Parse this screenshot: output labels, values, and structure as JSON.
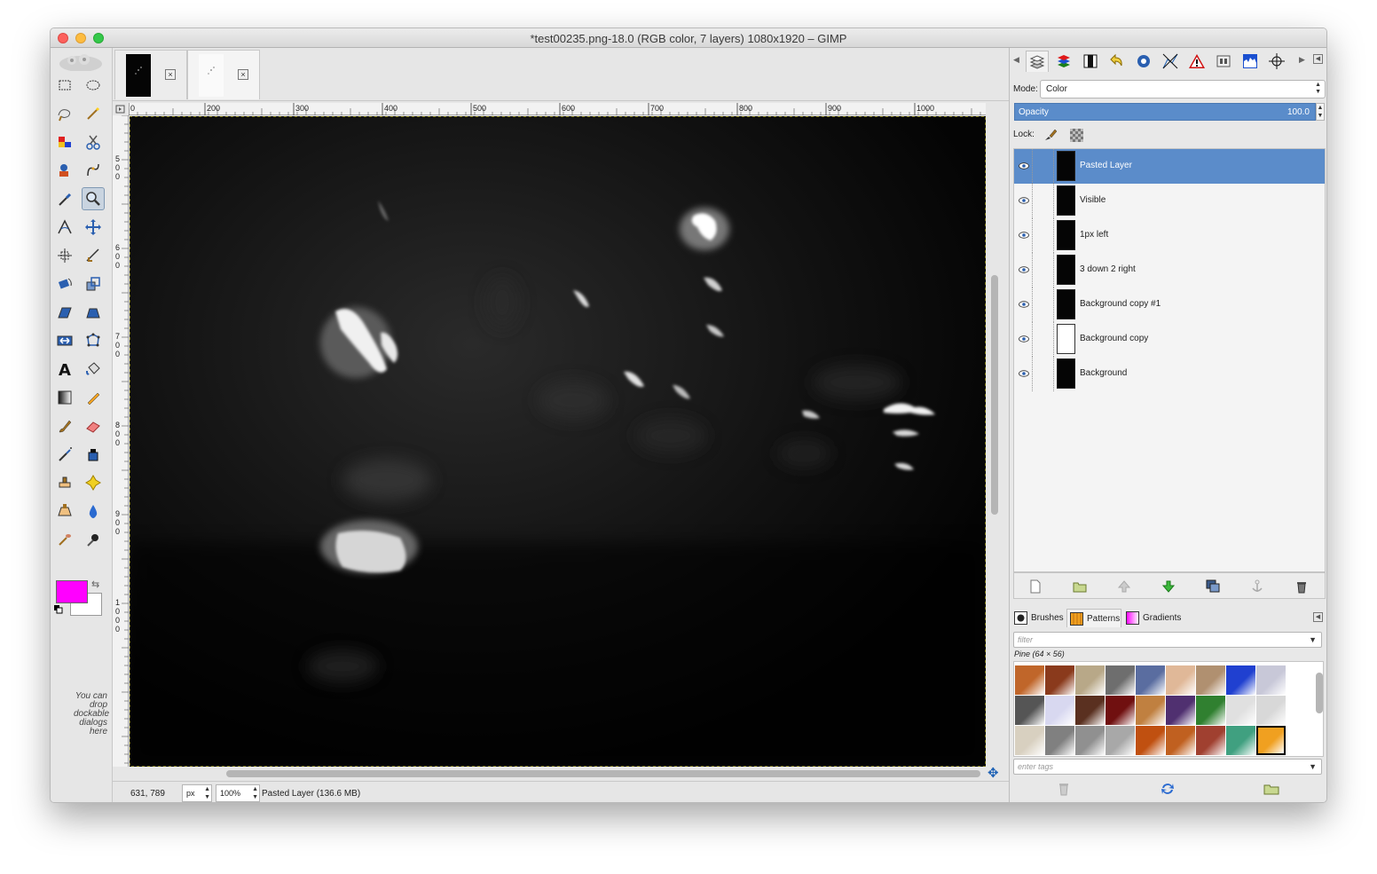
{
  "window": {
    "title": "*test00235.png-18.0 (RGB color, 7 layers) 1080x1920 – GIMP"
  },
  "toolbox": {
    "tools": [
      "rect-select-icon",
      "ellipse-select-icon",
      "free-select-icon",
      "fuzzy-select-icon",
      "by-color-select-icon",
      "scissors-select-icon",
      "foreground-select-icon",
      "paths-icon",
      "color-picker-icon",
      "zoom-icon",
      "measure-icon",
      "move-icon",
      "align-icon",
      "crop-icon",
      "rotate-icon",
      "scale-icon",
      "shear-icon",
      "perspective-icon",
      "flip-icon",
      "cage-icon",
      "text-icon",
      "bucket-fill-icon",
      "gradient-icon",
      "pencil-icon",
      "paintbrush-icon",
      "eraser-icon",
      "airbrush-icon",
      "ink-icon",
      "clone-icon",
      "heal-icon",
      "perspective-clone-icon",
      "blur-icon",
      "smudge-icon",
      "dodge-burn-icon"
    ],
    "active_tool": "zoom-icon",
    "fg_color": "#ff00ff",
    "bg_color": "#ffffff",
    "drop_hint": "You can drop dockable dialogs here"
  },
  "image_tabs": [
    {
      "name": "image-tab-test00235",
      "thumb": "dark",
      "close": "×"
    },
    {
      "name": "image-tab-second",
      "thumb": "light",
      "close": "×"
    }
  ],
  "rulers": {
    "h_labels": [
      "0",
      "200",
      "300",
      "400",
      "500",
      "600",
      "700",
      "800",
      "900",
      "1000"
    ],
    "v_labels": [
      "500",
      "600",
      "700",
      "800",
      "900",
      "1000"
    ]
  },
  "statusbar": {
    "coords": "631, 789",
    "unit": "px",
    "zoom": "100%",
    "layer_info": "Pasted Layer (136.6 MB)"
  },
  "layers_panel": {
    "mode_label": "Mode:",
    "mode_value": "Color",
    "opacity_label": "Opacity",
    "opacity_value": "100.0",
    "lock_label": "Lock:",
    "layers": [
      {
        "name": "Pasted Layer",
        "selected": true,
        "thumb": "dark"
      },
      {
        "name": "Visible",
        "selected": false,
        "thumb": "dark"
      },
      {
        "name": "1px left",
        "selected": false,
        "thumb": "dark"
      },
      {
        "name": "3 down 2 right",
        "selected": false,
        "thumb": "dark"
      },
      {
        "name": "Background copy #1",
        "selected": false,
        "thumb": "dark"
      },
      {
        "name": "Background copy",
        "selected": false,
        "thumb": "white"
      },
      {
        "name": "Background",
        "selected": false,
        "thumb": "dark"
      }
    ]
  },
  "resources_panel": {
    "tabs": [
      "Brushes",
      "Patterns",
      "Gradients"
    ],
    "active_tab": "Patterns",
    "filter_placeholder": "filter",
    "selected_pattern": "Pine (64 × 56)",
    "tags_placeholder": "enter tags",
    "pattern_colors": [
      "#c0662a",
      "#8a3a1c",
      "#b8a888",
      "#6e6e6e",
      "#5a6da0",
      "#e0b898",
      "#b09070",
      "#2040d0",
      "#c8c8d8",
      "#555555",
      "#d8d8f0",
      "#5a3020",
      "#701010",
      "#c08040",
      "#503070",
      "#308030",
      "#e0e0e0",
      "#d8d8d8",
      "#d8d0c0",
      "#808080",
      "#909090",
      "#a8a8a8",
      "#c05010",
      "#c06020",
      "#a04030",
      "#40a080",
      "#f0a020"
    ]
  }
}
